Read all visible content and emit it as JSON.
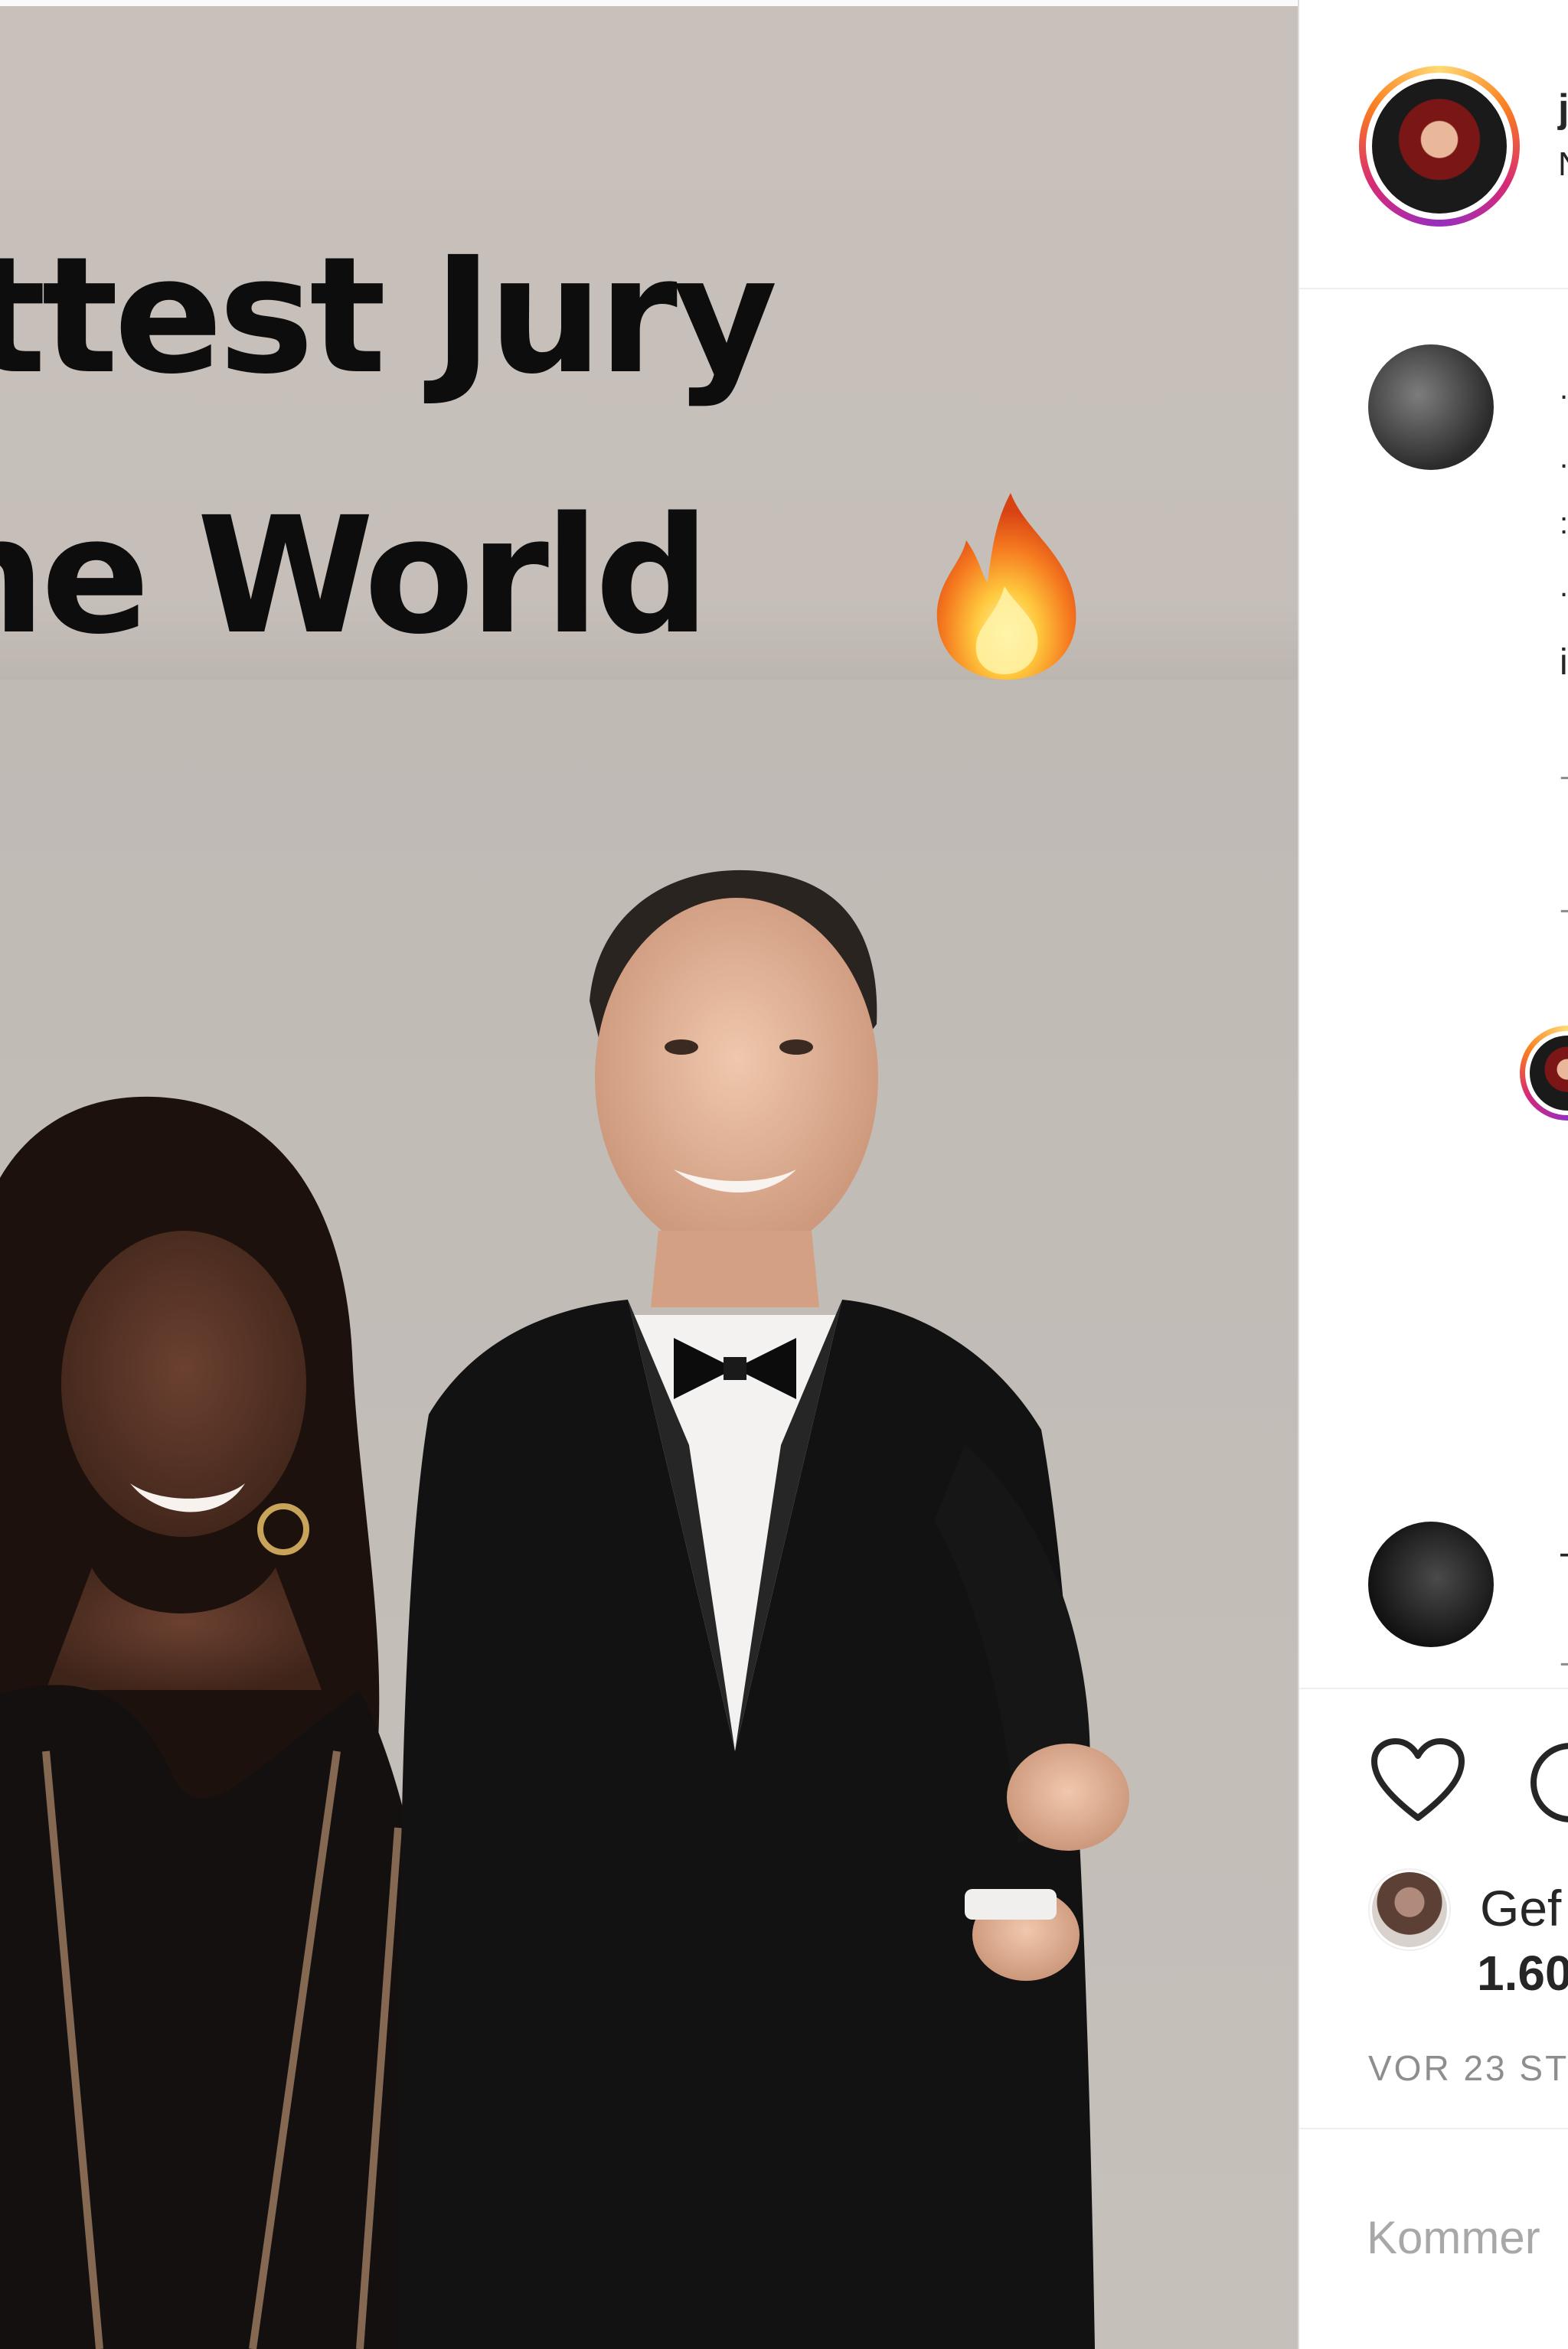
{
  "post": {
    "banner_line_1": "ttest Jury",
    "banner_line_2": "he World",
    "banner_emoji": "fire-emoji"
  },
  "header": {
    "username": "j",
    "subtitle": "N"
  },
  "comment_fragments": [
    ".",
    ".",
    ":",
    ".",
    "i",
    "-",
    "-",
    "T",
    "-"
  ],
  "actions": {
    "liked_by_label": "Gef",
    "likes_count": "1.60",
    "timestamp": "VOR 23 ST"
  },
  "comment_box": {
    "placeholder": "Kommer"
  },
  "colors": {
    "sidebar_bg": "#ffffff",
    "border": "#dbdbdb",
    "muted_text": "#8e8e8e",
    "primary_text": "#262626"
  }
}
